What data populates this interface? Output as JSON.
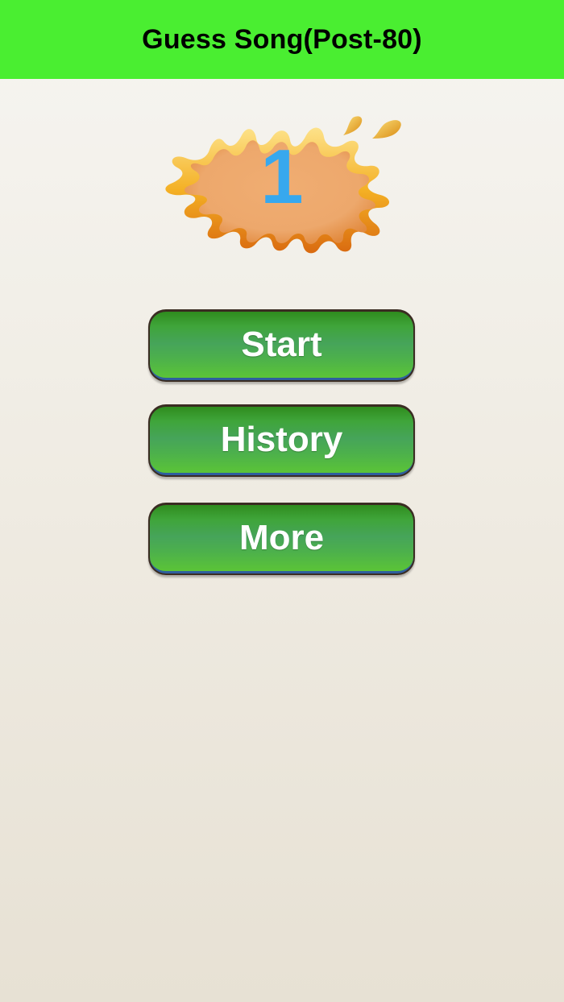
{
  "header": {
    "title": "Guess Song(Post-80)"
  },
  "level_badge": {
    "number": "1",
    "number_color": "#37a8ee",
    "icon": "orange-splash-icon"
  },
  "menu": {
    "buttons": [
      {
        "label": "Start"
      },
      {
        "label": "History"
      },
      {
        "label": "More"
      }
    ]
  },
  "colors": {
    "nav_bar": "#4aee31",
    "button_green": "#46a45a",
    "splash_orange": "#eda86c"
  }
}
